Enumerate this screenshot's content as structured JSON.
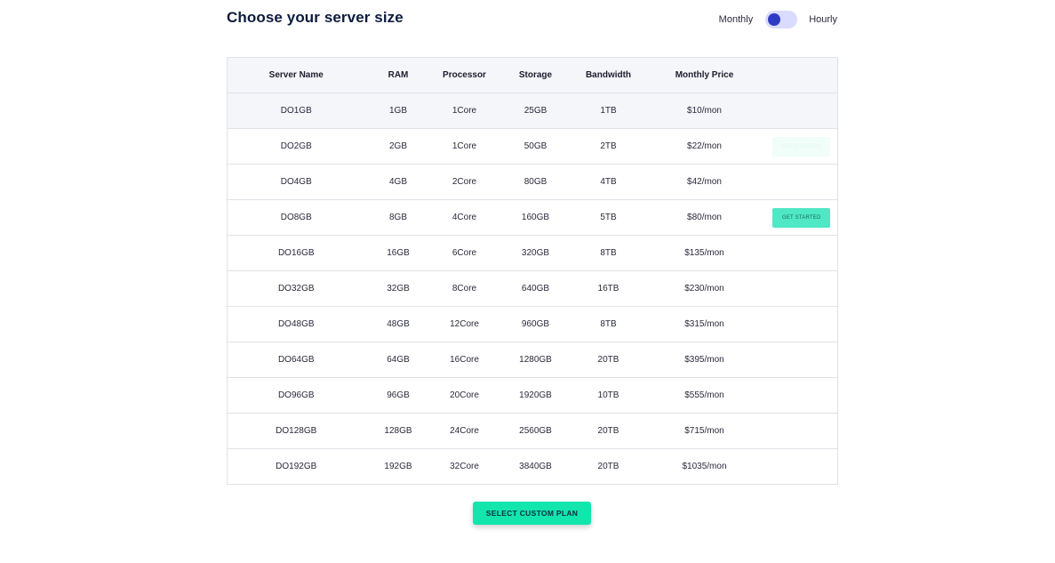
{
  "header": {
    "title": "Choose your server size",
    "billing": {
      "left_label": "Monthly",
      "right_label": "Hourly",
      "state": "monthly"
    }
  },
  "table": {
    "columns": [
      "Server Name",
      "RAM",
      "Processor",
      "Storage",
      "Bandwidth",
      "Monthly Price",
      ""
    ],
    "rows": [
      {
        "name": "DO1GB",
        "ram": "1GB",
        "processor": "1Core",
        "storage": "25GB",
        "bandwidth": "1TB",
        "price": "$10/mon",
        "action": ""
      },
      {
        "name": "DO2GB",
        "ram": "2GB",
        "processor": "1Core",
        "storage": "50GB",
        "bandwidth": "2TB",
        "price": "$22/mon",
        "action": "GET STARTED"
      },
      {
        "name": "DO4GB",
        "ram": "4GB",
        "processor": "2Core",
        "storage": "80GB",
        "bandwidth": "4TB",
        "price": "$42/mon",
        "action": ""
      },
      {
        "name": "DO8GB",
        "ram": "8GB",
        "processor": "4Core",
        "storage": "160GB",
        "bandwidth": "5TB",
        "price": "$80/mon",
        "action": "GET STARTED"
      },
      {
        "name": "DO16GB",
        "ram": "16GB",
        "processor": "6Core",
        "storage": "320GB",
        "bandwidth": "8TB",
        "price": "$135/mon",
        "action": ""
      },
      {
        "name": "DO32GB",
        "ram": "32GB",
        "processor": "8Core",
        "storage": "640GB",
        "bandwidth": "16TB",
        "price": "$230/mon",
        "action": ""
      },
      {
        "name": "DO48GB",
        "ram": "48GB",
        "processor": "12Core",
        "storage": "960GB",
        "bandwidth": "8TB",
        "price": "$315/mon",
        "action": ""
      },
      {
        "name": "DO64GB",
        "ram": "64GB",
        "processor": "16Core",
        "storage": "1280GB",
        "bandwidth": "20TB",
        "price": "$395/mon",
        "action": ""
      },
      {
        "name": "DO96GB",
        "ram": "96GB",
        "processor": "20Core",
        "storage": "1920GB",
        "bandwidth": "10TB",
        "price": "$555/mon",
        "action": ""
      },
      {
        "name": "DO128GB",
        "ram": "128GB",
        "processor": "24Core",
        "storage": "2560GB",
        "bandwidth": "20TB",
        "price": "$715/mon",
        "action": ""
      },
      {
        "name": "DO192GB",
        "ram": "192GB",
        "processor": "32Core",
        "storage": "3840GB",
        "bandwidth": "20TB",
        "price": "$1035/mon",
        "action": ""
      }
    ]
  },
  "footer": {
    "custom_plan_label": "SELECT CUSTOM PLAN"
  },
  "colors": {
    "accent": "#12e6ad",
    "toggle_track": "#d9dbff",
    "toggle_knob": "#2f3bc4",
    "get_started": "#4fe8c4",
    "title": "#0d1b3e"
  }
}
